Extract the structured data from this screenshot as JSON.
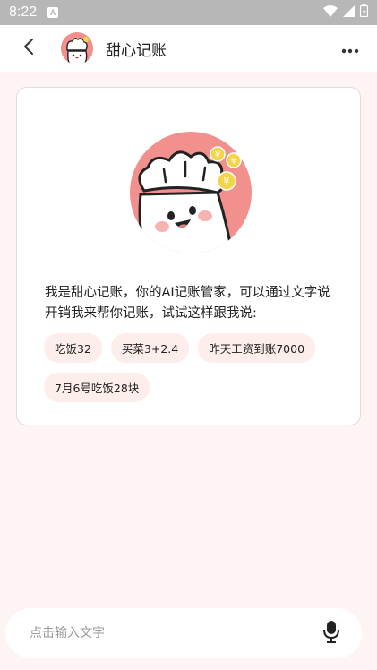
{
  "status_bar": {
    "time": "8:22",
    "notification_badge": "A",
    "icons": [
      "wifi-icon",
      "signal-icon",
      "battery-icon"
    ]
  },
  "header": {
    "title": "甜心记账",
    "back_icon": "chevron-left-icon",
    "more_icon": "more-dots-icon"
  },
  "assistant_card": {
    "intro_text": "我是甜心记账，你的AI记账管家，可以通过文字说开销我来帮你记账，试试这样跟我说:",
    "suggestions": [
      "吃饭32",
      "买菜3+2.4",
      "昨天工资到账7000",
      "7月6号吃饭28块"
    ]
  },
  "input_bar": {
    "placeholder": "点击输入文字",
    "value": "",
    "mic_icon": "microphone-icon"
  },
  "colors": {
    "status_bar": "#b7b7b7",
    "page_background": "#fdf4f3",
    "mascot_circle": "#f2908d",
    "chip_background": "#fdeeec",
    "coin": "#f3d54a"
  }
}
